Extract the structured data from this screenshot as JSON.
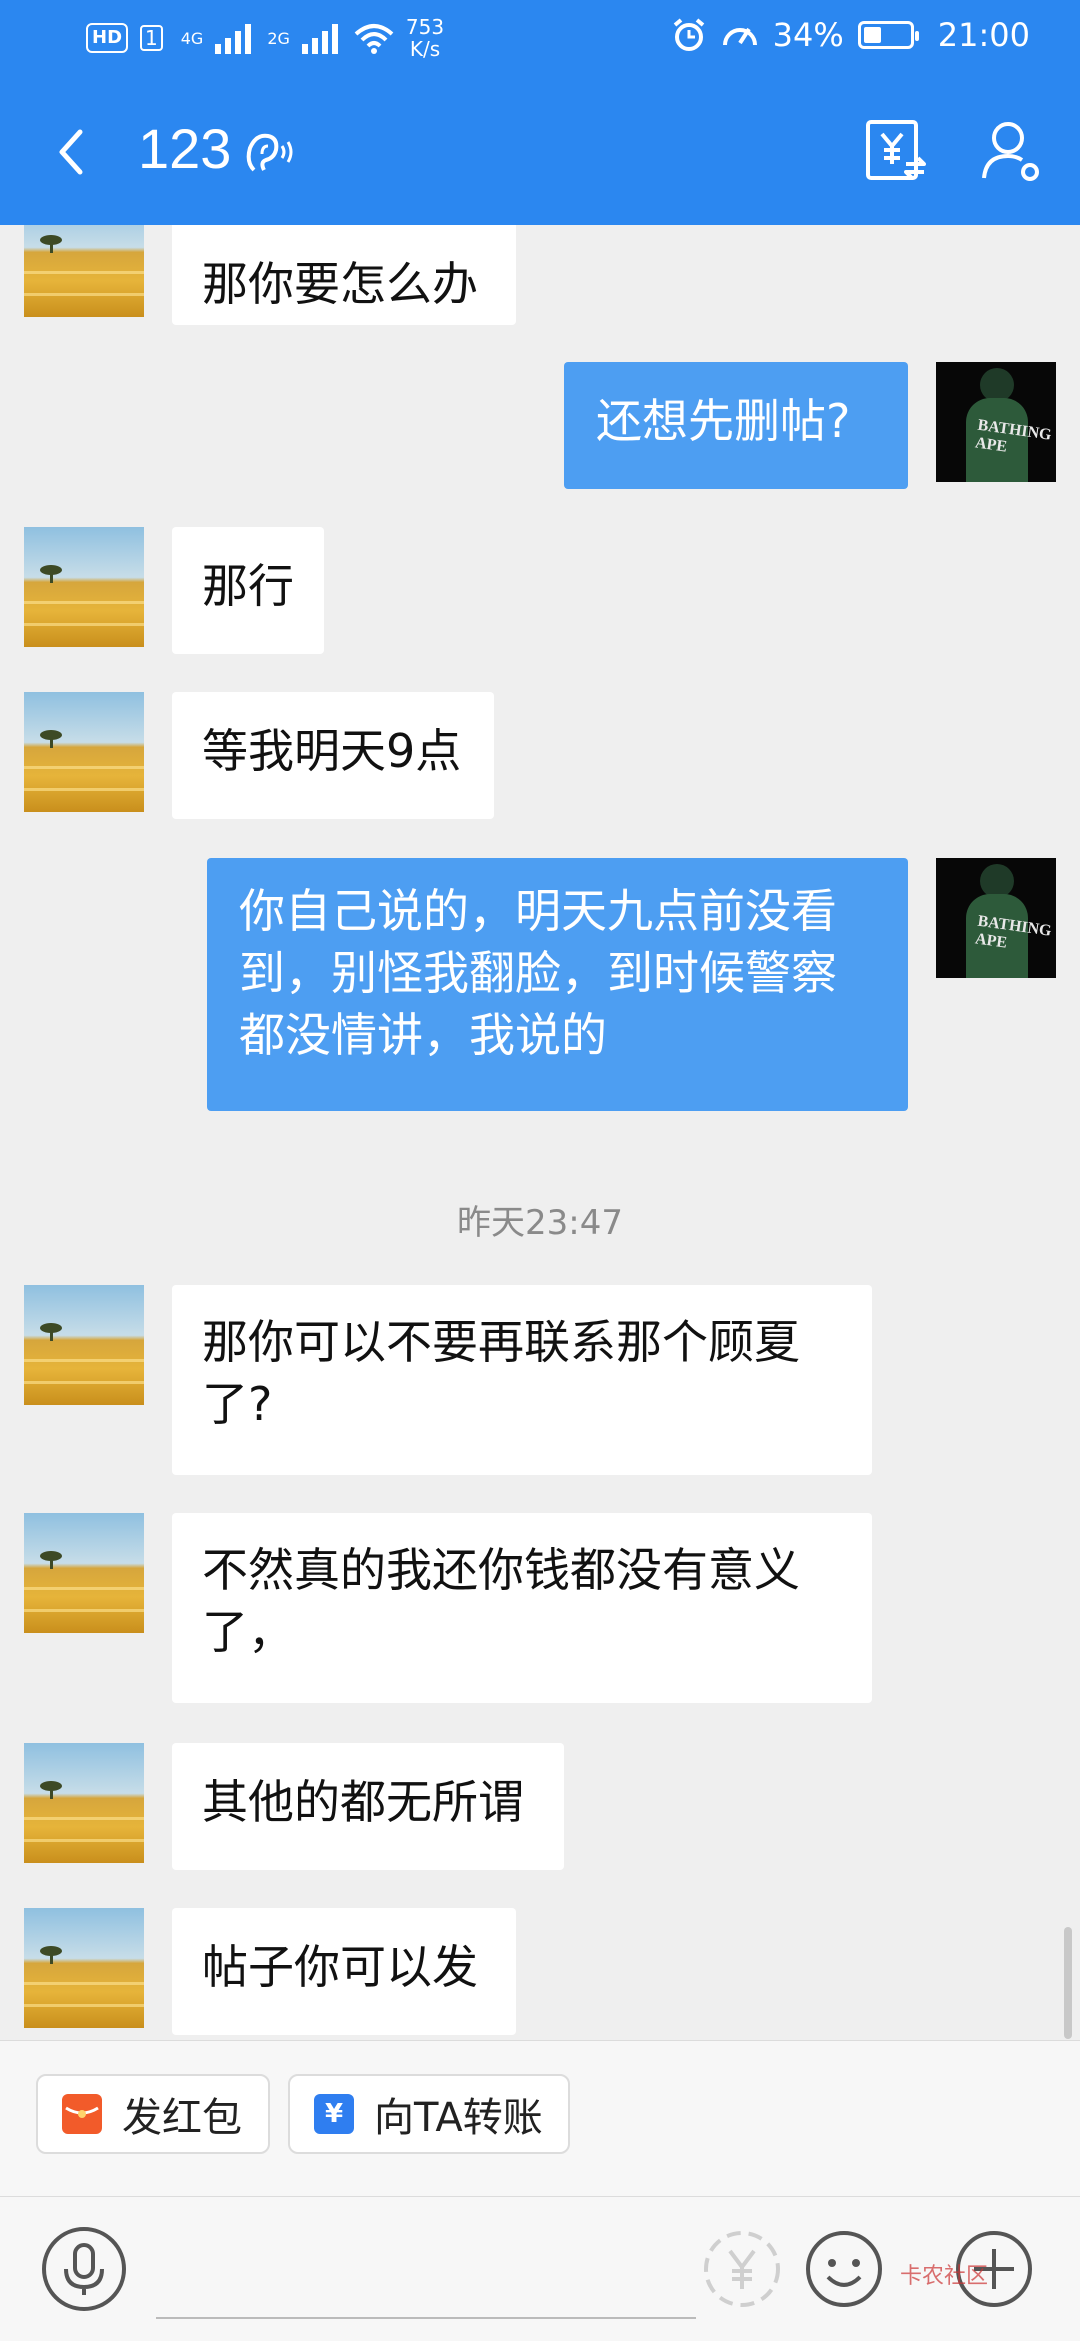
{
  "status_bar": {
    "hd": "HD",
    "sim": "1",
    "network1": "4G",
    "network2": "2G",
    "net_speed_value": "753",
    "net_speed_unit": "K/s",
    "battery": "34%",
    "battery_level": 0.34,
    "time": "21:00"
  },
  "header": {
    "title": "123",
    "back_icon": "chevron-left-icon",
    "ear_icon": "ear-icon",
    "transfer_icon": "yuan-transfer-icon",
    "profile_icon": "profile-settings-icon"
  },
  "messages": [
    {
      "side": "left",
      "text": "那你要怎么办"
    },
    {
      "side": "right",
      "text": "还想先删帖?"
    },
    {
      "side": "left",
      "text": "那行"
    },
    {
      "side": "left",
      "text": "等我明天9点"
    },
    {
      "side": "right",
      "text": "你自己说的，明天九点前没看到，别怪我翻脸，到时候警察都没情讲，我说的"
    },
    {
      "timestamp": "昨天23:47"
    },
    {
      "side": "left",
      "text": "那你可以不要再联系那个顾夏了?"
    },
    {
      "side": "left",
      "text": "不然真的我还你钱都没有意义了，"
    },
    {
      "side": "left",
      "text": "其他的都无所谓"
    },
    {
      "side": "left",
      "text": "帖子你可以发"
    }
  ],
  "avatar_right_text": "BATHING APE",
  "quick_actions": {
    "red_packet": "发红包",
    "transfer": "向TA转账",
    "transfer_symbol": "¥"
  },
  "input_bar": {
    "voice_icon": "microphone-icon",
    "yuan_icon": "yuan-icon",
    "emoji_icon": "emoji-icon",
    "plus_icon": "plus-icon",
    "watermark": "卡农社区"
  },
  "colors": {
    "brand_blue": "#2b87f0",
    "bubble_right": "#4d9ef2",
    "red_packet": "#f25b2a",
    "transfer_blue": "#2f7ef0"
  }
}
